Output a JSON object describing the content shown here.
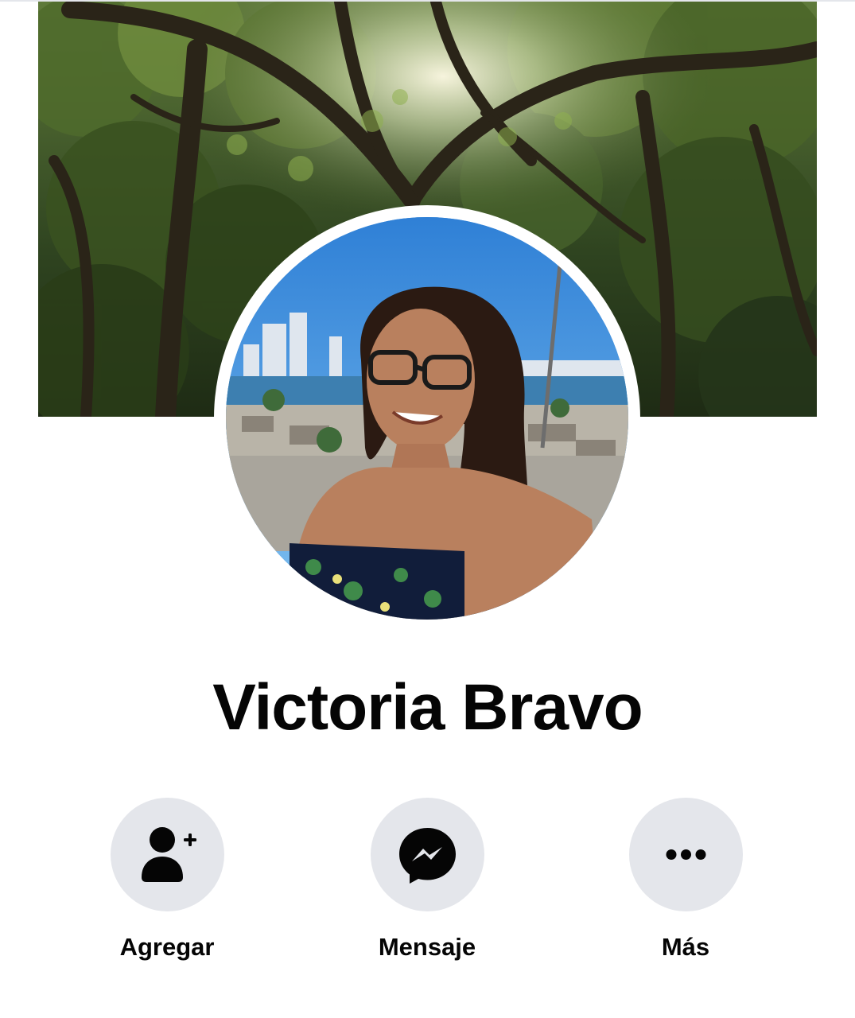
{
  "profile": {
    "name": "Victoria Bravo",
    "cover_photo_icon": "cover-photo",
    "avatar_icon": "profile-photo"
  },
  "actions": [
    {
      "label": "Agregar",
      "icon": "add-friend-icon"
    },
    {
      "label": "Mensaje",
      "icon": "messenger-icon"
    },
    {
      "label": "Más",
      "icon": "more-icon"
    }
  ],
  "colors": {
    "button_background": "#e4e6eb",
    "text": "#050505",
    "background": "#ffffff"
  }
}
